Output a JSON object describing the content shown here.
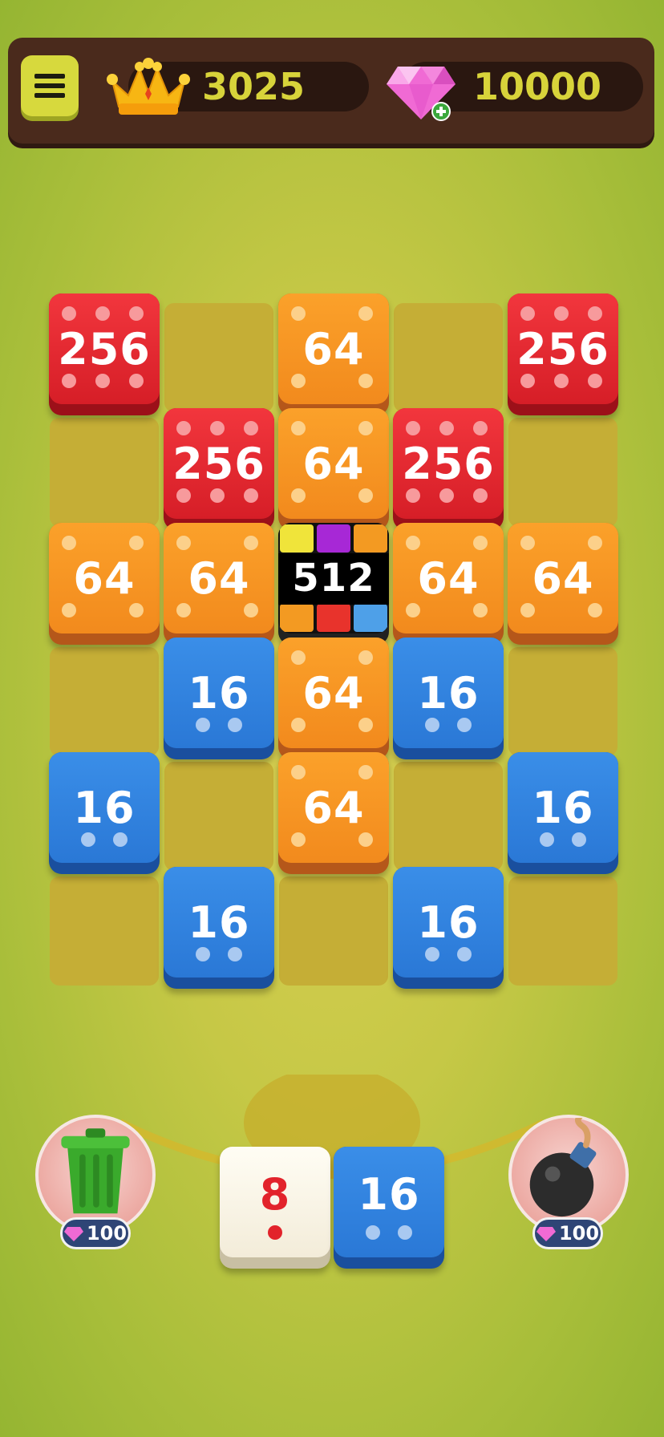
{
  "header": {
    "crowns": "3025",
    "gems": "10000"
  },
  "colors": {
    "red": "#e1262e",
    "orange": "#f59522",
    "blue": "#2f82e0",
    "white": "#faf5e6",
    "cell": "#c5ae36",
    "topbar": "#4a2a1c"
  },
  "board": {
    "tiles": [
      {
        "value": "256",
        "color": "red",
        "row": 0,
        "col": 0
      },
      {
        "value": "64",
        "color": "orange",
        "row": 0,
        "col": 2
      },
      {
        "value": "256",
        "color": "red",
        "row": 0,
        "col": 4
      },
      {
        "value": "256",
        "color": "red",
        "row": 1,
        "col": 1
      },
      {
        "value": "64",
        "color": "orange",
        "row": 1,
        "col": 2
      },
      {
        "value": "256",
        "color": "red",
        "row": 1,
        "col": 3
      },
      {
        "value": "64",
        "color": "orange",
        "row": 2,
        "col": 0
      },
      {
        "value": "64",
        "color": "orange",
        "row": 2,
        "col": 1
      },
      {
        "value": "512",
        "color": "rainbow",
        "row": 2,
        "col": 2
      },
      {
        "value": "64",
        "color": "orange",
        "row": 2,
        "col": 3
      },
      {
        "value": "64",
        "color": "orange",
        "row": 2,
        "col": 4
      },
      {
        "value": "16",
        "color": "blue",
        "row": 3,
        "col": 1
      },
      {
        "value": "64",
        "color": "orange",
        "row": 3,
        "col": 2
      },
      {
        "value": "16",
        "color": "blue",
        "row": 3,
        "col": 3
      },
      {
        "value": "16",
        "color": "blue",
        "row": 4,
        "col": 0
      },
      {
        "value": "64",
        "color": "orange",
        "row": 4,
        "col": 2
      },
      {
        "value": "16",
        "color": "blue",
        "row": 4,
        "col": 4
      },
      {
        "value": "16",
        "color": "blue",
        "row": 5,
        "col": 1
      },
      {
        "value": "16",
        "color": "blue",
        "row": 5,
        "col": 3
      }
    ]
  },
  "tray": {
    "current_value": "8",
    "next_value": "16",
    "trash": {
      "icon": "trash-can-icon",
      "cost": "100"
    },
    "bomb": {
      "icon": "bomb-icon",
      "cost": "100"
    }
  }
}
